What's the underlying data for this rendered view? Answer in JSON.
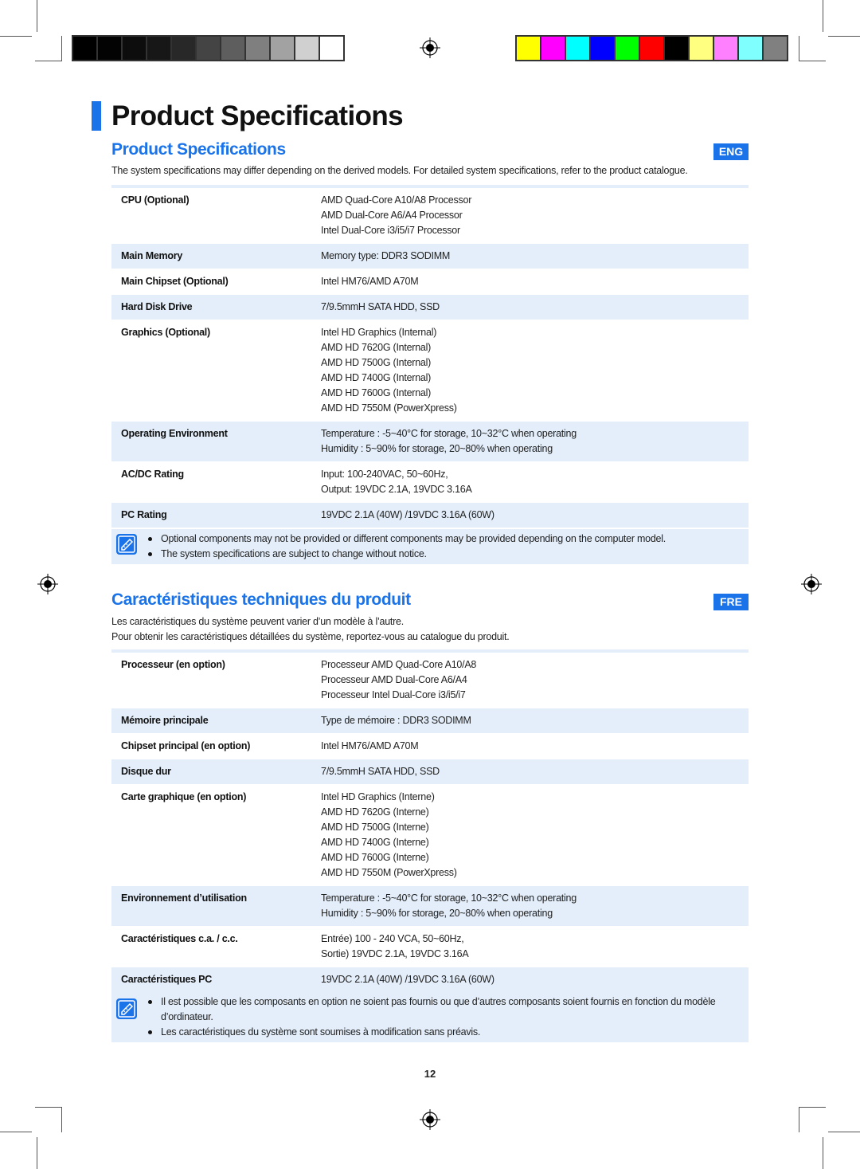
{
  "print_marks": {
    "grayscale_colors": [
      "#000000",
      "#030303",
      "#0d0d0d",
      "#171717",
      "#282828",
      "#444444",
      "#5e5e5e",
      "#7f7f7f",
      "#a2a2a2",
      "#d0d0d0",
      "#ffffff"
    ],
    "color_colors": [
      "#ffff00",
      "#ff00ff",
      "#00ffff",
      "#0000ff",
      "#00ff00",
      "#ff0000",
      "#000000",
      "#ffff80",
      "#ff80ff",
      "#80ffff",
      "#808080"
    ]
  },
  "accent_color": "#1a73e8",
  "page_title": "Product Specifications",
  "sections": [
    {
      "title": "Product Specifications",
      "lang": "ENG",
      "intro": [
        "The system specifications may differ depending on the derived models. For detailed system specifications, refer to the product catalogue."
      ],
      "rows": [
        {
          "label": "CPU (Optional)",
          "values": [
            "AMD Quad-Core A10/A8 Processor",
            "AMD Dual-Core A6/A4 Processor",
            "Intel Dual-Core i3/i5/i7 Processor"
          ]
        },
        {
          "label": "Main Memory",
          "values": [
            "Memory type: DDR3 SODIMM"
          ]
        },
        {
          "label": "Main Chipset (Optional)",
          "values": [
            "Intel HM76/AMD A70M"
          ]
        },
        {
          "label": "Hard Disk Drive",
          "values": [
            "7/9.5mmH SATA HDD, SSD"
          ]
        },
        {
          "label": "Graphics (Optional)",
          "values": [
            "Intel HD Graphics (Internal)",
            "AMD HD 7620G (Internal)",
            "AMD HD 7500G (Internal)",
            "AMD HD 7400G (Internal)",
            "AMD HD 7600G (Internal)",
            "AMD HD 7550M (PowerXpress)"
          ]
        },
        {
          "label": "Operating Environment",
          "values": [
            "Temperature : -5~40°C for storage, 10~32°C when operating",
            "Humidity : 5~90% for storage, 20~80% when operating"
          ]
        },
        {
          "label": "AC/DC Rating",
          "values": [
            "Input: 100-240VAC, 50~60Hz,",
            "Output: 19VDC 2.1A, 19VDC 3.16A"
          ]
        },
        {
          "label": "PC Rating",
          "values": [
            "19VDC 2.1A (40W) /19VDC 3.16A (60W)"
          ]
        }
      ],
      "notes": [
        "Optional components may not be provided or different components may be provided depending on the computer model.",
        "The system specifications are subject to change without notice."
      ]
    },
    {
      "title": "Caractéristiques techniques du produit",
      "lang": "FRE",
      "intro": [
        "Les caractéristiques du système peuvent varier d’un modèle à l’autre.",
        "Pour obtenir les caractéristiques détaillées du système, reportez-vous au catalogue du produit."
      ],
      "rows": [
        {
          "label": "Processeur (en option)",
          "values": [
            "Processeur AMD Quad-Core A10/A8",
            "Processeur AMD Dual-Core A6/A4",
            "Processeur Intel Dual-Core i3/i5/i7"
          ]
        },
        {
          "label": "Mémoire principale",
          "values": [
            "Type de mémoire : DDR3 SODIMM"
          ]
        },
        {
          "label": "Chipset principal (en option)",
          "values": [
            "Intel HM76/AMD A70M"
          ]
        },
        {
          "label": "Disque dur",
          "values": [
            "7/9.5mmH SATA HDD, SSD"
          ]
        },
        {
          "label": "Carte graphique (en option)",
          "values": [
            "Intel HD Graphics (Interne)",
            "AMD HD 7620G (Interne)",
            "AMD HD 7500G (Interne)",
            "AMD HD 7400G (Interne)",
            "AMD HD 7600G (Interne)",
            "AMD HD 7550M (PowerXpress)"
          ]
        },
        {
          "label": "Environnement d’utilisation",
          "values": [
            "Temperature : -5~40°C for storage, 10~32°C when operating",
            "Humidity : 5~90% for storage, 20~80% when operating"
          ]
        },
        {
          "label": "Caractéristiques c.a. / c.c.",
          "values": [
            "Entrée) 100 - 240 VCA, 50~60Hz,",
            "Sortie) 19VDC 2.1A, 19VDC 3.16A"
          ]
        },
        {
          "label": "Caractéristiques PC",
          "values": [
            "19VDC 2.1A (40W) /19VDC 3.16A (60W)"
          ]
        }
      ],
      "notes": [
        "Il est possible que les composants en option ne soient pas fournis ou que d’autres composants soient fournis en fonction du modèle d’ordinateur.",
        "Les caractéristiques du système sont soumises à modification sans préavis."
      ]
    }
  ],
  "page_number": "12"
}
